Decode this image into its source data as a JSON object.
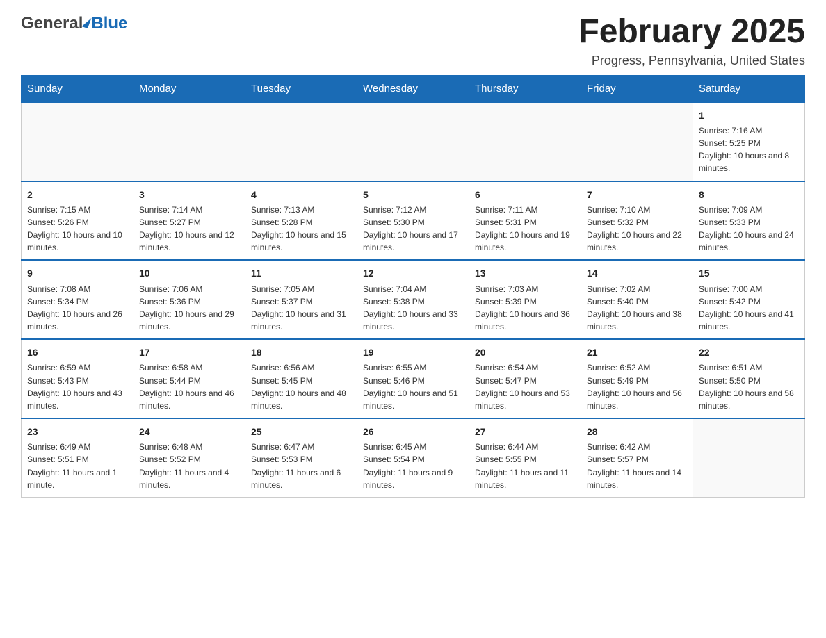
{
  "header": {
    "logo_general": "General",
    "logo_blue": "Blue",
    "month_title": "February 2025",
    "subtitle": "Progress, Pennsylvania, United States"
  },
  "weekdays": [
    "Sunday",
    "Monday",
    "Tuesday",
    "Wednesday",
    "Thursday",
    "Friday",
    "Saturday"
  ],
  "weeks": [
    [
      {
        "day": "",
        "info": ""
      },
      {
        "day": "",
        "info": ""
      },
      {
        "day": "",
        "info": ""
      },
      {
        "day": "",
        "info": ""
      },
      {
        "day": "",
        "info": ""
      },
      {
        "day": "",
        "info": ""
      },
      {
        "day": "1",
        "info": "Sunrise: 7:16 AM\nSunset: 5:25 PM\nDaylight: 10 hours and 8 minutes."
      }
    ],
    [
      {
        "day": "2",
        "info": "Sunrise: 7:15 AM\nSunset: 5:26 PM\nDaylight: 10 hours and 10 minutes."
      },
      {
        "day": "3",
        "info": "Sunrise: 7:14 AM\nSunset: 5:27 PM\nDaylight: 10 hours and 12 minutes."
      },
      {
        "day": "4",
        "info": "Sunrise: 7:13 AM\nSunset: 5:28 PM\nDaylight: 10 hours and 15 minutes."
      },
      {
        "day": "5",
        "info": "Sunrise: 7:12 AM\nSunset: 5:30 PM\nDaylight: 10 hours and 17 minutes."
      },
      {
        "day": "6",
        "info": "Sunrise: 7:11 AM\nSunset: 5:31 PM\nDaylight: 10 hours and 19 minutes."
      },
      {
        "day": "7",
        "info": "Sunrise: 7:10 AM\nSunset: 5:32 PM\nDaylight: 10 hours and 22 minutes."
      },
      {
        "day": "8",
        "info": "Sunrise: 7:09 AM\nSunset: 5:33 PM\nDaylight: 10 hours and 24 minutes."
      }
    ],
    [
      {
        "day": "9",
        "info": "Sunrise: 7:08 AM\nSunset: 5:34 PM\nDaylight: 10 hours and 26 minutes."
      },
      {
        "day": "10",
        "info": "Sunrise: 7:06 AM\nSunset: 5:36 PM\nDaylight: 10 hours and 29 minutes."
      },
      {
        "day": "11",
        "info": "Sunrise: 7:05 AM\nSunset: 5:37 PM\nDaylight: 10 hours and 31 minutes."
      },
      {
        "day": "12",
        "info": "Sunrise: 7:04 AM\nSunset: 5:38 PM\nDaylight: 10 hours and 33 minutes."
      },
      {
        "day": "13",
        "info": "Sunrise: 7:03 AM\nSunset: 5:39 PM\nDaylight: 10 hours and 36 minutes."
      },
      {
        "day": "14",
        "info": "Sunrise: 7:02 AM\nSunset: 5:40 PM\nDaylight: 10 hours and 38 minutes."
      },
      {
        "day": "15",
        "info": "Sunrise: 7:00 AM\nSunset: 5:42 PM\nDaylight: 10 hours and 41 minutes."
      }
    ],
    [
      {
        "day": "16",
        "info": "Sunrise: 6:59 AM\nSunset: 5:43 PM\nDaylight: 10 hours and 43 minutes."
      },
      {
        "day": "17",
        "info": "Sunrise: 6:58 AM\nSunset: 5:44 PM\nDaylight: 10 hours and 46 minutes."
      },
      {
        "day": "18",
        "info": "Sunrise: 6:56 AM\nSunset: 5:45 PM\nDaylight: 10 hours and 48 minutes."
      },
      {
        "day": "19",
        "info": "Sunrise: 6:55 AM\nSunset: 5:46 PM\nDaylight: 10 hours and 51 minutes."
      },
      {
        "day": "20",
        "info": "Sunrise: 6:54 AM\nSunset: 5:47 PM\nDaylight: 10 hours and 53 minutes."
      },
      {
        "day": "21",
        "info": "Sunrise: 6:52 AM\nSunset: 5:49 PM\nDaylight: 10 hours and 56 minutes."
      },
      {
        "day": "22",
        "info": "Sunrise: 6:51 AM\nSunset: 5:50 PM\nDaylight: 10 hours and 58 minutes."
      }
    ],
    [
      {
        "day": "23",
        "info": "Sunrise: 6:49 AM\nSunset: 5:51 PM\nDaylight: 11 hours and 1 minute."
      },
      {
        "day": "24",
        "info": "Sunrise: 6:48 AM\nSunset: 5:52 PM\nDaylight: 11 hours and 4 minutes."
      },
      {
        "day": "25",
        "info": "Sunrise: 6:47 AM\nSunset: 5:53 PM\nDaylight: 11 hours and 6 minutes."
      },
      {
        "day": "26",
        "info": "Sunrise: 6:45 AM\nSunset: 5:54 PM\nDaylight: 11 hours and 9 minutes."
      },
      {
        "day": "27",
        "info": "Sunrise: 6:44 AM\nSunset: 5:55 PM\nDaylight: 11 hours and 11 minutes."
      },
      {
        "day": "28",
        "info": "Sunrise: 6:42 AM\nSunset: 5:57 PM\nDaylight: 11 hours and 14 minutes."
      },
      {
        "day": "",
        "info": ""
      }
    ]
  ]
}
